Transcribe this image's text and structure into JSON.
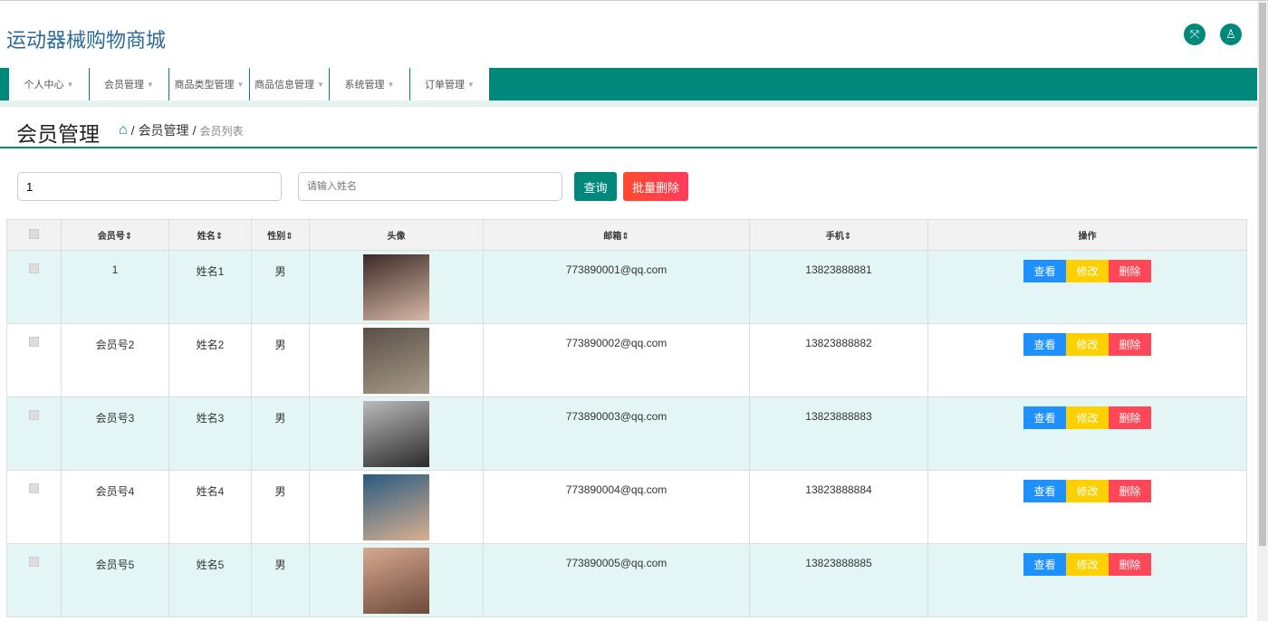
{
  "app_title": "运动器械购物商城",
  "nav": [
    "个人中心",
    "会员管理",
    "商品类型管理",
    "商品信息管理",
    "系统管理",
    "订单管理"
  ],
  "page_title": "会员管理",
  "breadcrumb": {
    "section": "会员管理",
    "current": "会员列表"
  },
  "search": {
    "member_value": "1",
    "name_placeholder": "请输入姓名",
    "query_label": "查询",
    "batch_delete_label": "批量删除"
  },
  "columns": [
    "会员号",
    "姓名",
    "性别",
    "头像",
    "邮箱",
    "手机",
    "操作"
  ],
  "actions": {
    "view": "查看",
    "edit": "修改",
    "delete": "删除"
  },
  "colors": {
    "teal": "#00897b",
    "view": "#1e90ff",
    "edit": "#ffd000",
    "delete": "#ff4757"
  },
  "rows": [
    {
      "id": "1",
      "name": "姓名1",
      "gender": "男",
      "email": "773890001@qq.com",
      "phone": "13823888881"
    },
    {
      "id": "会员号2",
      "name": "姓名2",
      "gender": "男",
      "email": "773890002@qq.com",
      "phone": "13823888882"
    },
    {
      "id": "会员号3",
      "name": "姓名3",
      "gender": "男",
      "email": "773890003@qq.com",
      "phone": "13823888883"
    },
    {
      "id": "会员号4",
      "name": "姓名4",
      "gender": "男",
      "email": "773890004@qq.com",
      "phone": "13823888884"
    },
    {
      "id": "会员号5",
      "name": "姓名5",
      "gender": "男",
      "email": "773890005@qq.com",
      "phone": "13823888885"
    }
  ]
}
